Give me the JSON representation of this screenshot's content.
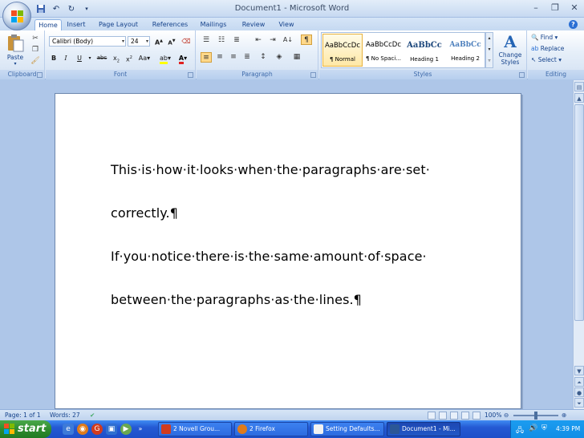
{
  "window": {
    "title": "Document1 - Microsoft Word"
  },
  "tabs": [
    "Home",
    "Insert",
    "Page Layout",
    "References",
    "Mailings",
    "Review",
    "View"
  ],
  "clipboard": {
    "paste_label": "Paste",
    "group_label": "Clipboard"
  },
  "font": {
    "family": "Calibri (Body)",
    "size": "24",
    "group_label": "Font"
  },
  "paragraph": {
    "group_label": "Paragraph"
  },
  "styles": {
    "items": [
      {
        "sample": "AaBbCcDc",
        "name": "¶ Normal"
      },
      {
        "sample": "AaBbCcDc",
        "name": "¶ No Spaci..."
      },
      {
        "sample": "AaBbCc",
        "name": "Heading 1"
      },
      {
        "sample": "AaBbCc",
        "name": "Heading 2"
      }
    ],
    "group_label": "Styles",
    "change_styles_label": "Change Styles"
  },
  "editing": {
    "find": "Find",
    "replace": "Replace",
    "select": "Select",
    "group_label": "Editing"
  },
  "document": {
    "paragraphs": [
      "This·is·how·it·looks·when·the·paragraphs·are·set·",
      "correctly.¶",
      "If·you·notice·there·is·the·same·amount·of·space·",
      "between·the·paragraphs·as·the·lines.¶"
    ]
  },
  "status": {
    "page": "Page: 1 of 1",
    "words": "Words: 27",
    "zoom": "100%"
  },
  "taskbar": {
    "start": "start",
    "tasks": [
      "2 Novell Grou...",
      "2 Firefox",
      "Setting Defaults...",
      "Document1 - Mi..."
    ],
    "clock": "4:39 PM"
  },
  "colors": {
    "ribbon_bg": "#d3e1f3",
    "taskbar": "#2459d3",
    "start_green": "#2f8c2f"
  }
}
